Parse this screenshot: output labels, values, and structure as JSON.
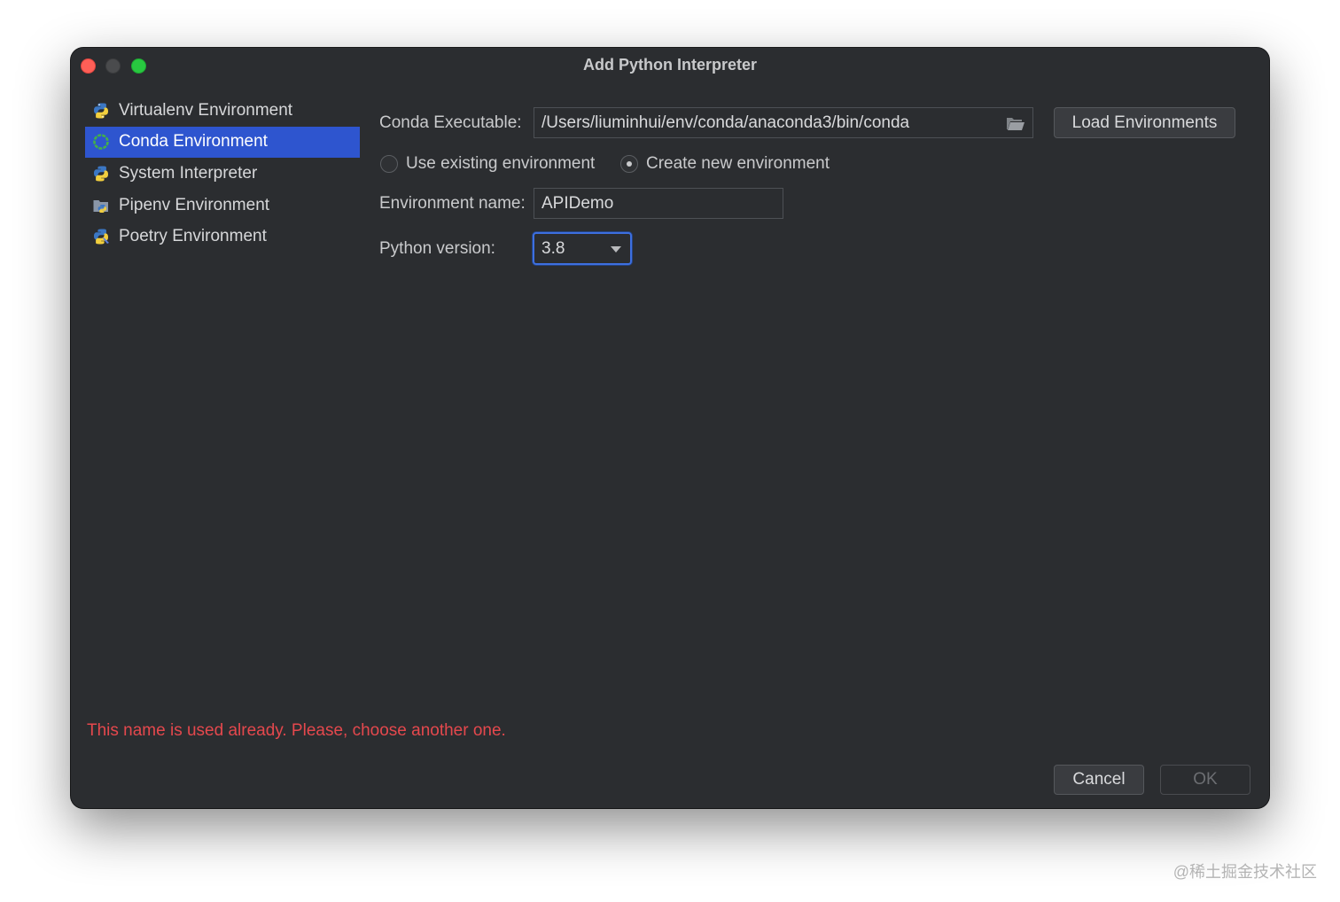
{
  "window": {
    "title": "Add Python Interpreter"
  },
  "sidebar": {
    "items": [
      {
        "label": "Virtualenv Environment",
        "icon": "python-icon",
        "selected": false
      },
      {
        "label": "Conda Environment",
        "icon": "conda-icon",
        "selected": true
      },
      {
        "label": "System Interpreter",
        "icon": "python-icon",
        "selected": false
      },
      {
        "label": "Pipenv Environment",
        "icon": "pipenv-icon",
        "selected": false
      },
      {
        "label": "Poetry Environment",
        "icon": "poetry-icon",
        "selected": false
      }
    ]
  },
  "form": {
    "conda_executable_label": "Conda Executable:",
    "conda_executable_value": "/Users/liuminhui/env/conda/anaconda3/bin/conda",
    "load_environments_label": "Load Environments",
    "use_existing_label": "Use existing environment",
    "create_new_label": "Create new environment",
    "selected_mode": "create_new",
    "env_name_label": "Environment name:",
    "env_name_value": "APIDemo",
    "python_version_label": "Python version:",
    "python_version_value": "3.8"
  },
  "error_message": "This name is used already. Please, choose another one.",
  "buttons": {
    "cancel": "Cancel",
    "ok": "OK"
  },
  "watermark": "@稀土掘金技术社区",
  "colors": {
    "background": "#2b2d30",
    "selection": "#2e55cf",
    "error": "#e5484d",
    "focus": "#3d6fe0"
  }
}
